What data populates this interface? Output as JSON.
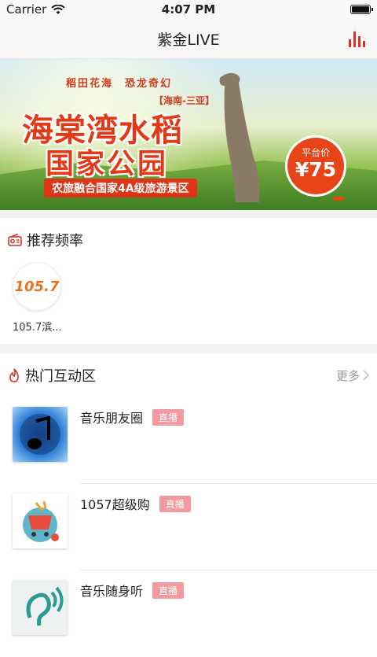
{
  "status": {
    "carrier": "Carrier",
    "time": "4:07 PM"
  },
  "navbar": {
    "title": "紫金LIVE"
  },
  "banner": {
    "tagline": "稻田花海　恐龙奇幻",
    "subtag": "【海南-三亚】",
    "headline1": "海棠湾水稻",
    "headline2": "国家公园",
    "note": "农旅融合国家4A级旅游景区",
    "price_label": "平台价",
    "price_value": "¥75"
  },
  "recommend": {
    "title": "推荐频率",
    "items": [
      {
        "name": "105.7滨...",
        "logo_text": "105.7"
      }
    ]
  },
  "hot": {
    "title": "热门互动区",
    "more": "更多",
    "items": [
      {
        "title": "音乐朋友圈",
        "badge": "直播"
      },
      {
        "title": "1057超级购",
        "badge": "直播"
      },
      {
        "title": "音乐随身听",
        "badge": "直播"
      }
    ]
  },
  "colors": {
    "accent": "#d8312a",
    "badge": "#f39aa0"
  }
}
